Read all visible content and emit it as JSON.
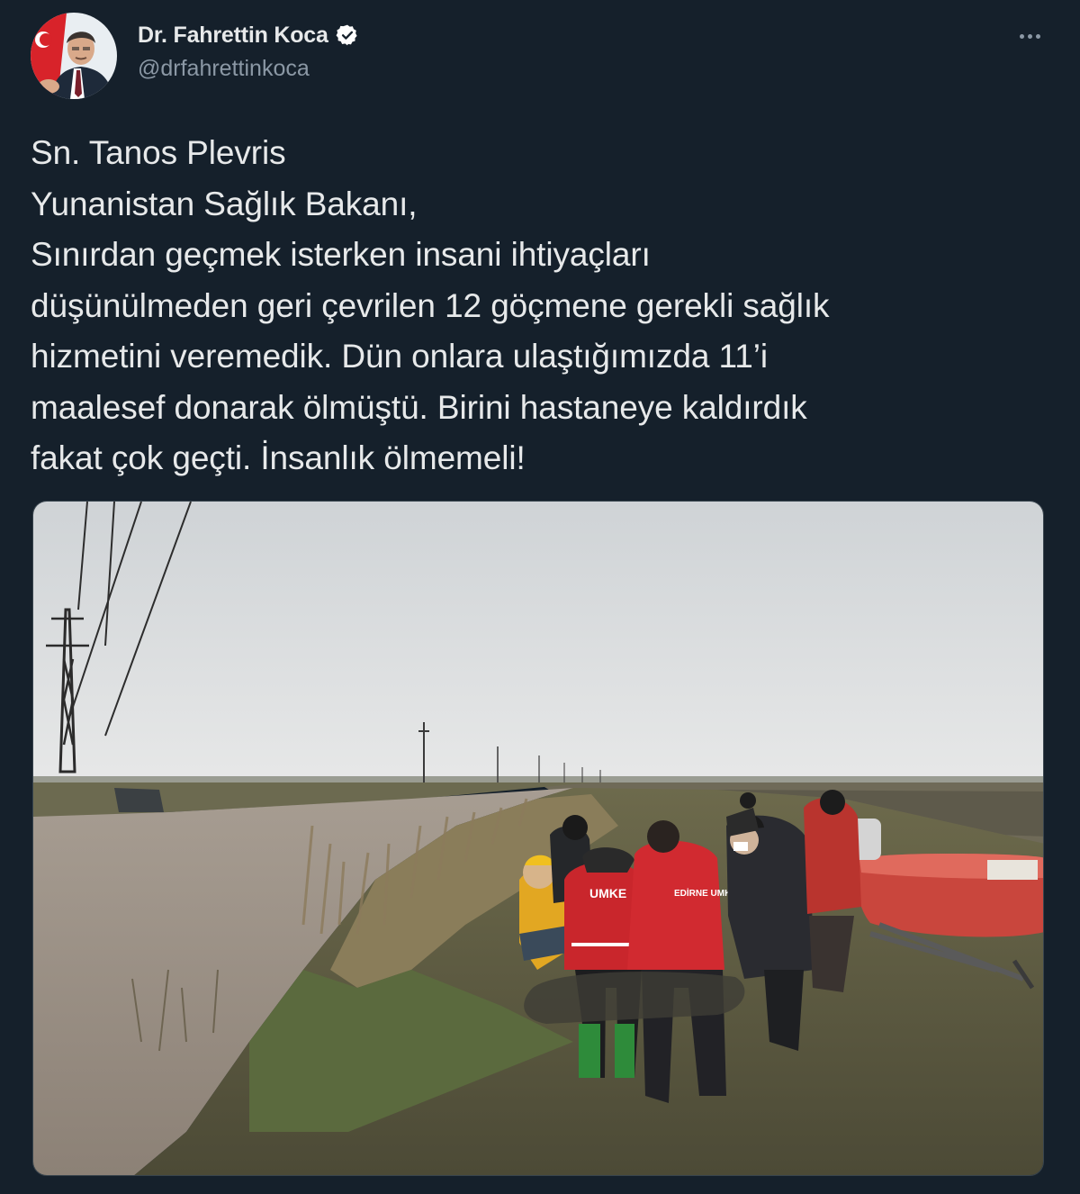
{
  "tweet": {
    "author": {
      "display_name": "Dr. Fahrettin Koca",
      "handle": "@drfahrettinkoca",
      "verified": true,
      "avatar_icon": "profile-photo"
    },
    "more_icon": "ellipsis-icon",
    "text_lines": [
      "Sn. Tanos Plevris",
      "Yunanistan Sağlık Bakanı,",
      "Sınırdan geçmek isterken insani ihtiyaçları",
      "düşünülmeden geri çevrilen 12 göçmene gerekli sağlık",
      "hizmetini veremedik. Dün onlara ulaştığımızda 11’i",
      "maalesef donarak ölmüştü. Birini hastaneye kaldırdık",
      "fakat çok geçti. İnsanlık ölmemeli!"
    ],
    "photo_lettering": [
      "UMKE",
      "EDİRNE UMKE"
    ]
  },
  "colors": {
    "background": "#15202b",
    "text_primary": "#e7e9ea",
    "text_secondary": "#8b98a5",
    "verified_badge": "#ffffff",
    "jacket_red": "#c9262c",
    "boat_red": "#d9534a"
  }
}
